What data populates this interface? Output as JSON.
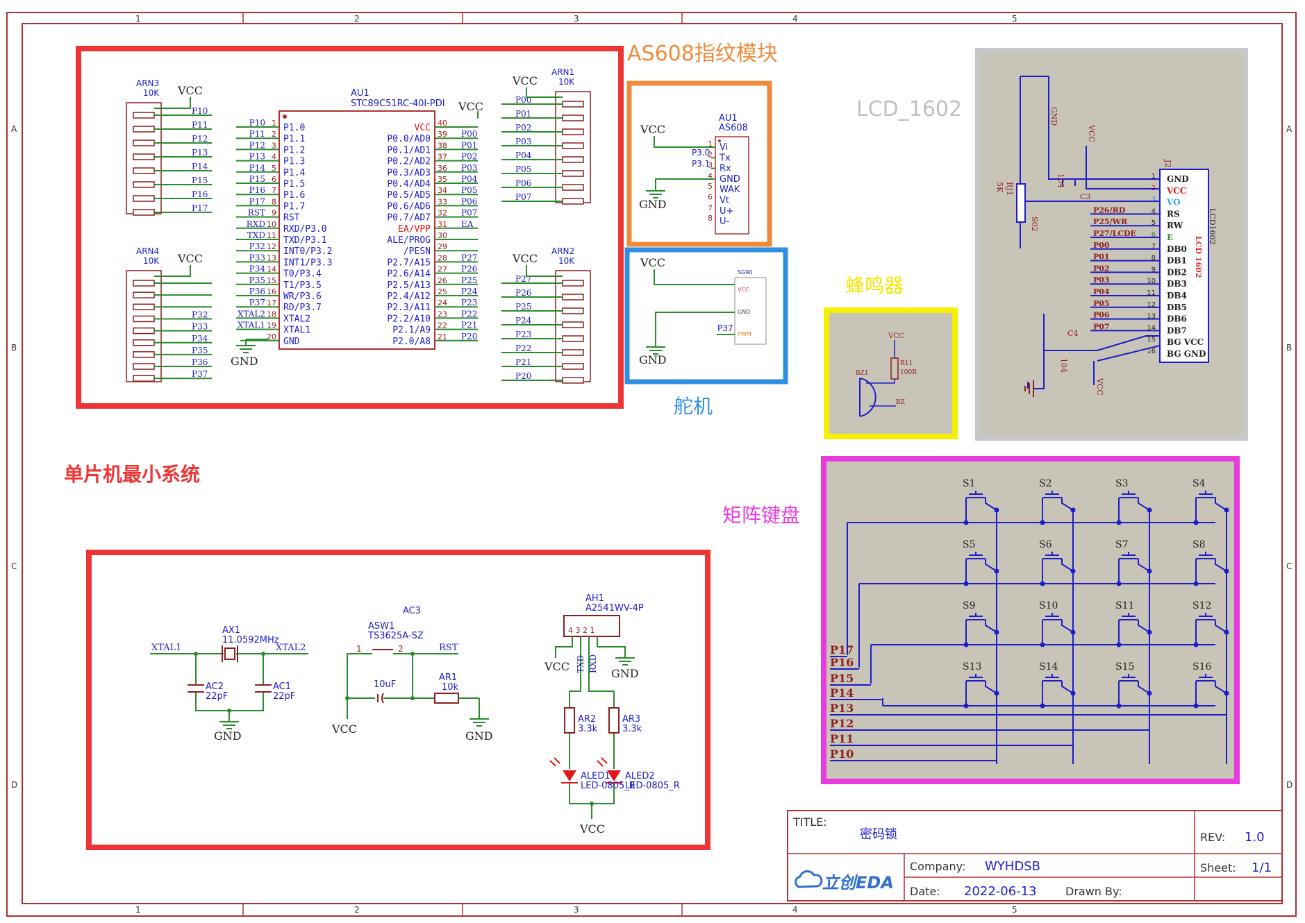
{
  "sheet": {
    "col_markers": [
      "1",
      "2",
      "3",
      "4",
      "5"
    ],
    "row_markers": [
      "A",
      "B",
      "C",
      "D"
    ]
  },
  "sections": {
    "mcu": "单片机最小系统",
    "as608": "AS608指纹模块",
    "servo": "舵机",
    "buzzer": "蜂鸣器",
    "lcd": "LCD_1602",
    "keypad": "矩阵键盘"
  },
  "mcu": {
    "ref": "AU1",
    "part": "STC89C51RC-40I-PDI",
    "vcc": "VCC",
    "gnd": "GND",
    "left_pins": [
      {
        "num": "1",
        "name": "P1.0",
        "net": "P10"
      },
      {
        "num": "2",
        "name": "P1.1",
        "net": "P11"
      },
      {
        "num": "3",
        "name": "P1.2",
        "net": "P12"
      },
      {
        "num": "4",
        "name": "P1.3",
        "net": "P13"
      },
      {
        "num": "5",
        "name": "P1.4",
        "net": "P14"
      },
      {
        "num": "6",
        "name": "P1.5",
        "net": "P15"
      },
      {
        "num": "7",
        "name": "P1.6",
        "net": "P16"
      },
      {
        "num": "8",
        "name": "P1.7",
        "net": "P17"
      },
      {
        "num": "9",
        "name": "RST",
        "net": "RST"
      },
      {
        "num": "10",
        "name": "RXD/P3.0",
        "net": "RXD"
      },
      {
        "num": "11",
        "name": "TXD/P3.1",
        "net": "TXD"
      },
      {
        "num": "12",
        "name": "INT0/P3.2",
        "net": "P32"
      },
      {
        "num": "13",
        "name": "INT1/P3.3",
        "net": "P33"
      },
      {
        "num": "14",
        "name": "T0/P3.4",
        "net": "P34"
      },
      {
        "num": "15",
        "name": "T1/P3.5",
        "net": "P35"
      },
      {
        "num": "16",
        "name": "WR/P3.6",
        "net": "P36"
      },
      {
        "num": "17",
        "name": "RD/P3.7",
        "net": "P37"
      },
      {
        "num": "18",
        "name": "XTAL2",
        "net": "XTAL2"
      },
      {
        "num": "19",
        "name": "XTAL1",
        "net": "XTAL1"
      },
      {
        "num": "20",
        "name": "GND",
        "net": ""
      }
    ],
    "right_pins": [
      {
        "num": "40",
        "name": "VCC",
        "net": ""
      },
      {
        "num": "39",
        "name": "P0.0/AD0",
        "net": "P00"
      },
      {
        "num": "38",
        "name": "P0.1/AD1",
        "net": "P01"
      },
      {
        "num": "37",
        "name": "P0.2/AD2",
        "net": "P02"
      },
      {
        "num": "36",
        "name": "P0.3/AD3",
        "net": "P03"
      },
      {
        "num": "35",
        "name": "P0.4/AD4",
        "net": "P04"
      },
      {
        "num": "34",
        "name": "P0.5/AD5",
        "net": "P05"
      },
      {
        "num": "33",
        "name": "P0.6/AD6",
        "net": "P06"
      },
      {
        "num": "32",
        "name": "P0.7/AD7",
        "net": "P07"
      },
      {
        "num": "31",
        "name": "EA/VPP",
        "net": "EA"
      },
      {
        "num": "30",
        "name": "ALE/PROG",
        "net": ""
      },
      {
        "num": "29",
        "name": "/PESN",
        "net": ""
      },
      {
        "num": "28",
        "name": "P2.7/A15",
        "net": "P27"
      },
      {
        "num": "27",
        "name": "P2.6/A14",
        "net": "P26"
      },
      {
        "num": "26",
        "name": "P2.5/A13",
        "net": "P25"
      },
      {
        "num": "25",
        "name": "P2.4/A12",
        "net": "P24"
      },
      {
        "num": "24",
        "name": "P2.3/A11",
        "net": "P23"
      },
      {
        "num": "23",
        "name": "P2.2/A10",
        "net": "P22"
      },
      {
        "num": "22",
        "name": "P2.1/A9",
        "net": "P21"
      },
      {
        "num": "21",
        "name": "P2.0/A8",
        "net": "P20"
      }
    ]
  },
  "arrays": [
    {
      "ref": "ARN3",
      "val": "10K",
      "vcc": "VCC",
      "nets": [
        "P10",
        "P11",
        "P12",
        "P13",
        "P14",
        "P15",
        "P16",
        "P17"
      ]
    },
    {
      "ref": "ARN4",
      "val": "10K",
      "vcc": "VCC",
      "nets": [
        "",
        "",
        "",
        "P32",
        "P33",
        "P34",
        "P35",
        "P36",
        "P37"
      ]
    },
    {
      "ref": "ARN1",
      "val": "10K",
      "vcc": "VCC",
      "nets": [
        "P00",
        "P01",
        "P02",
        "P03",
        "P04",
        "P05",
        "P06",
        "P07"
      ]
    },
    {
      "ref": "ARN2",
      "val": "10K",
      "vcc": "VCC",
      "nets": [
        "P27",
        "P26",
        "P25",
        "P24",
        "P23",
        "P22",
        "P21",
        "P20"
      ]
    }
  ],
  "as608": {
    "ref": "AU1",
    "part": "AS608",
    "vcc": "VCC",
    "gnd": "GND",
    "pins": [
      {
        "num": "1",
        "name": "Vi"
      },
      {
        "num": "2",
        "name": "Tx"
      },
      {
        "num": "3",
        "name": "Rx"
      },
      {
        "num": "4",
        "name": "GND"
      },
      {
        "num": "5",
        "name": "WAK"
      },
      {
        "num": "6",
        "name": "Vt"
      },
      {
        "num": "7",
        "name": "U+"
      },
      {
        "num": "8",
        "name": "U-"
      }
    ],
    "nets": [
      "P3.0",
      "P3.1"
    ]
  },
  "servo": {
    "part": "SG90",
    "vcc": "VCC",
    "gnd": "GND",
    "net": "P37",
    "pins": [
      "VCC",
      "GND",
      "PWM"
    ]
  },
  "buzzer": {
    "vcc": "VCC",
    "ref": "BZ1",
    "res": "R11",
    "res_val": "100R",
    "net": "BZ"
  },
  "lcd": {
    "ref": "J2",
    "part": "LCD1602",
    "part_red": "LCD 1602",
    "pot": "RJ1",
    "pot_val": "5K",
    "pot_net": "S02",
    "cap1": "C3",
    "cap1_val": "104",
    "cap2": "C4",
    "cap2_val": "104",
    "gnd": "GND",
    "vcc": "VCC",
    "pins": [
      {
        "num": "1",
        "name": "GND",
        "net": ""
      },
      {
        "num": "2",
        "name": "VCC",
        "net": ""
      },
      {
        "num": "3",
        "name": "VO",
        "net": ""
      },
      {
        "num": "4",
        "name": "RS",
        "net": "P26/RD"
      },
      {
        "num": "5",
        "name": "RW",
        "net": "P25/WR"
      },
      {
        "num": "6",
        "name": "E",
        "net": "P27/LCDE"
      },
      {
        "num": "7",
        "name": "DB0",
        "net": "P00"
      },
      {
        "num": "8",
        "name": "DB1",
        "net": "P01"
      },
      {
        "num": "9",
        "name": "DB2",
        "net": "P02"
      },
      {
        "num": "10",
        "name": "DB3",
        "net": "P03"
      },
      {
        "num": "11",
        "name": "DB4",
        "net": "P04"
      },
      {
        "num": "12",
        "name": "DB5",
        "net": "P05"
      },
      {
        "num": "13",
        "name": "DB6",
        "net": "P06"
      },
      {
        "num": "14",
        "name": "DB7",
        "net": "P07"
      },
      {
        "num": "15",
        "name": "BG VCC",
        "net": ""
      },
      {
        "num": "16",
        "name": "BG GND",
        "net": ""
      }
    ]
  },
  "keypad": {
    "switches": [
      "S1",
      "S2",
      "S3",
      "S4",
      "S5",
      "S6",
      "S7",
      "S8",
      "S9",
      "S10",
      "S11",
      "S12",
      "S13",
      "S14",
      "S15",
      "S16"
    ],
    "nets": [
      "P17",
      "P16",
      "P15",
      "P14",
      "P13",
      "P12",
      "P11",
      "P10"
    ]
  },
  "clock": {
    "ref": "AX1",
    "val": "11.0592MHz",
    "net1": "XTAL1",
    "net2": "XTAL2",
    "c2": "AC2",
    "c2_val": "22pF",
    "c1": "AC1",
    "c1_val": "22pF",
    "gnd": "GND"
  },
  "reset": {
    "ref": "AC3",
    "sw": "ASW1",
    "sw_part": "TS3625A-SZ",
    "pin1": "1",
    "pin2": "2",
    "net": "RST",
    "cap_val": "10uF",
    "res": "AR1",
    "res_val": "10k",
    "vcc": "VCC",
    "gnd": "GND"
  },
  "uart": {
    "ref": "AH1",
    "part": "A2541WV-4P",
    "pins": "4 3 2 1",
    "vcc": "VCC",
    "gnd": "GND",
    "txd": "TXD",
    "rxd": "RXD",
    "r1": "AR2",
    "r1_val": "3.3k",
    "r2": "AR3",
    "r2_val": "3.3k",
    "led1": "ALED1",
    "led1_part": "LED-0805_R",
    "led2": "ALED2",
    "led2_part": "LED-0805_R"
  },
  "titleblock": {
    "title_label": "TITLE:",
    "title": "密码锁",
    "rev_label": "REV:",
    "rev": "1.0",
    "company_label": "Company:",
    "company": "WYHDSB",
    "sheet_label": "Sheet:",
    "sheet": "1/1",
    "date_label": "Date:",
    "date": "2022-06-13",
    "drawn_label": "Drawn By:",
    "logo": "立创EDA"
  },
  "colors": {
    "frame": "#c0392b",
    "mcu_box": "#ee3535",
    "as608_box": "#f08a3a",
    "servo_box": "#2f8fe0",
    "buzzer_box": "#f5f000",
    "lcd_box": "#c8c8c8",
    "keypad_box": "#e83be0",
    "wire": "#2b8a2b",
    "blue": "#1c1cc8",
    "dark_red": "#8b1e1e",
    "panel": "#c9c4b8"
  }
}
